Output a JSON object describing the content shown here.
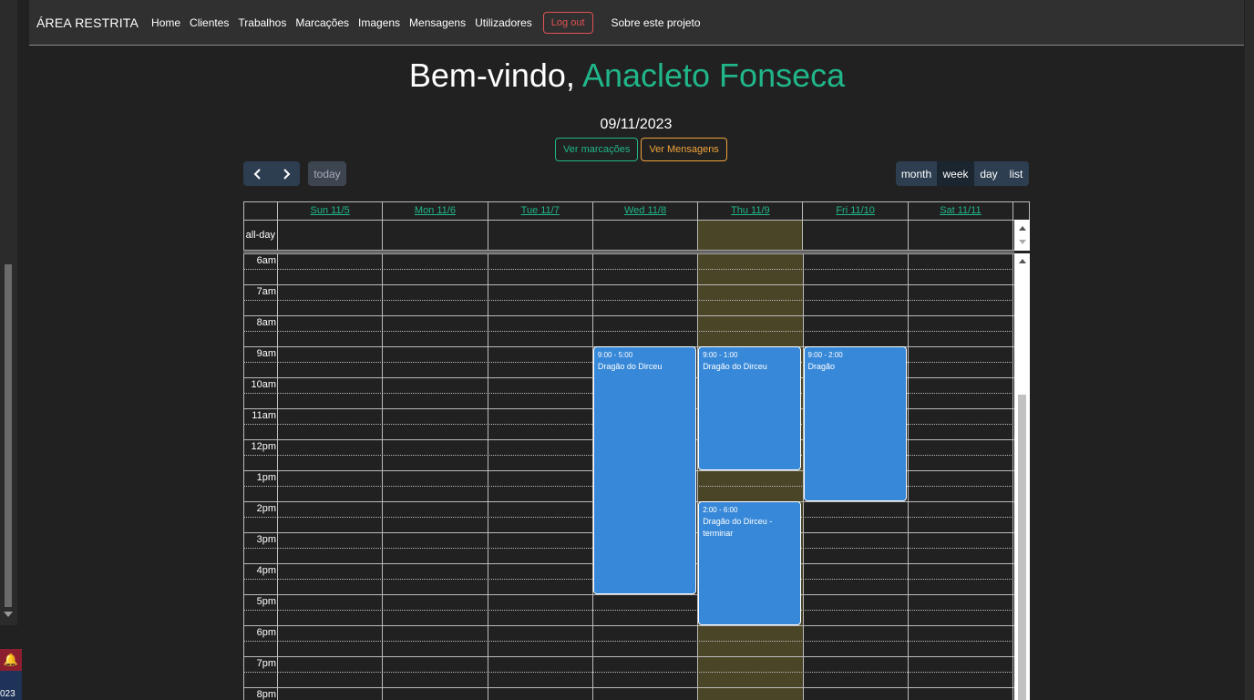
{
  "navbar": {
    "brand": "ÁREA RESTRITA",
    "links": [
      "Home",
      "Clientes",
      "Trabalhos",
      "Marcações",
      "Imagens",
      "Mensagens",
      "Utilizadores"
    ],
    "logout": "Log out",
    "about": "Sobre este projeto"
  },
  "welcome": {
    "prefix": "Bem-vindo,",
    "name": "Anacleto Fonseca"
  },
  "date": "09/11/2023",
  "buttons": {
    "appointments": "Ver marcações",
    "messages": "Ver Mensagens"
  },
  "toolbar": {
    "prev_icon": "chevron-left",
    "next_icon": "chevron-right",
    "today": "today",
    "views": [
      "month",
      "week",
      "day",
      "list"
    ],
    "active_view": "week"
  },
  "calendar": {
    "days": [
      "Sun 11/5",
      "Mon 11/6",
      "Tue 11/7",
      "Wed 11/8",
      "Thu 11/9",
      "Fri 11/10",
      "Sat 11/11"
    ],
    "today_index": 4,
    "allday_label": "all-day",
    "hours": [
      "6am",
      "7am",
      "8am",
      "9am",
      "10am",
      "11am",
      "12pm",
      "1pm",
      "2pm",
      "3pm",
      "4pm",
      "5pm",
      "6pm",
      "7pm",
      "8pm"
    ],
    "events": [
      {
        "day": 3,
        "start": 9,
        "end": 17,
        "time": "9:00 - 5:00",
        "title": "Dragão do Dirceu"
      },
      {
        "day": 4,
        "start": 9,
        "end": 13,
        "time": "9:00 - 1:00",
        "title": "Dragão do Dirceu"
      },
      {
        "day": 4,
        "start": 14,
        "end": 18,
        "time": "2:00 - 6:00",
        "title": "Dragão do Dirceu - terminar"
      },
      {
        "day": 5,
        "start": 9,
        "end": 14,
        "time": "9:00 - 2:00",
        "title": "Dragão"
      }
    ],
    "event_color": "#3788d8",
    "today_color": "#4b4527",
    "accent_color": "#21b58a"
  },
  "left_strip": {
    "year_fragment": "023",
    "bell_icon": "bell-icon"
  }
}
